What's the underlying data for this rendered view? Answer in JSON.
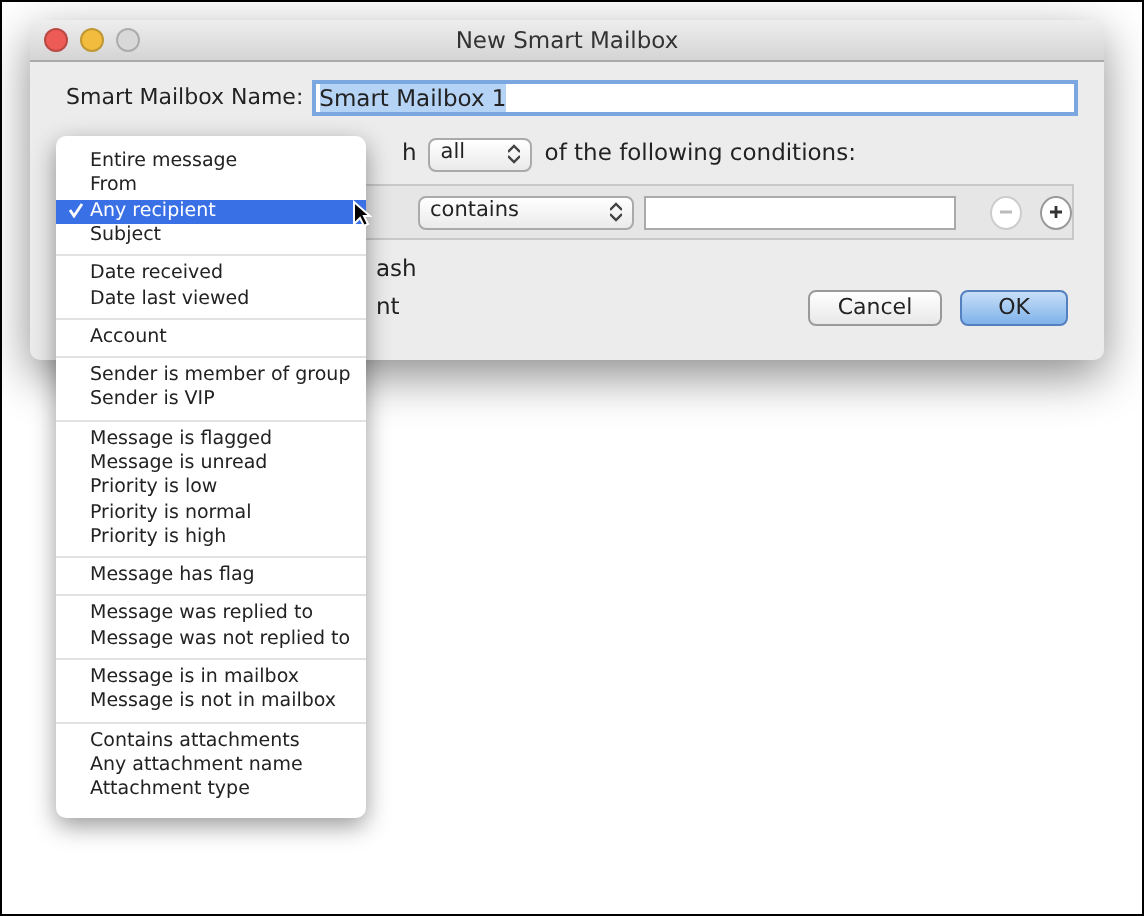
{
  "window": {
    "title": "New Smart Mailbox"
  },
  "name_label": "Smart Mailbox Name:",
  "name_value": "Smart Mailbox 1",
  "match_fragment": "h",
  "match_select": "all",
  "match_suffix": "of the following conditions:",
  "condition": {
    "operator": "contains",
    "remove_disabled": true
  },
  "option_fragments": [
    "ash",
    "nt"
  ],
  "buttons": [
    {
      "label": "Cancel",
      "default": false
    },
    {
      "label": "OK",
      "default": true
    }
  ],
  "menu": [
    [
      {
        "label": "Entire message",
        "selected": false
      },
      {
        "label": "From",
        "selected": false
      },
      {
        "label": "Any recipient",
        "selected": true
      },
      {
        "label": "Subject",
        "selected": false
      }
    ],
    [
      {
        "label": "Date received",
        "selected": false
      },
      {
        "label": "Date last viewed",
        "selected": false
      }
    ],
    [
      {
        "label": "Account",
        "selected": false
      }
    ],
    [
      {
        "label": "Sender is member of group",
        "selected": false
      },
      {
        "label": "Sender is VIP",
        "selected": false
      }
    ],
    [
      {
        "label": "Message is flagged",
        "selected": false
      },
      {
        "label": "Message is unread",
        "selected": false
      },
      {
        "label": "Priority is low",
        "selected": false
      },
      {
        "label": "Priority is normal",
        "selected": false
      },
      {
        "label": "Priority is high",
        "selected": false
      }
    ],
    [
      {
        "label": "Message has flag",
        "selected": false
      }
    ],
    [
      {
        "label": "Message was replied to",
        "selected": false
      },
      {
        "label": "Message was not replied to",
        "selected": false
      }
    ],
    [
      {
        "label": "Message is in mailbox",
        "selected": false
      },
      {
        "label": "Message is not in mailbox",
        "selected": false
      }
    ],
    [
      {
        "label": "Contains attachments",
        "selected": false
      },
      {
        "label": "Any attachment name",
        "selected": false
      },
      {
        "label": "Attachment type",
        "selected": false
      }
    ]
  ]
}
